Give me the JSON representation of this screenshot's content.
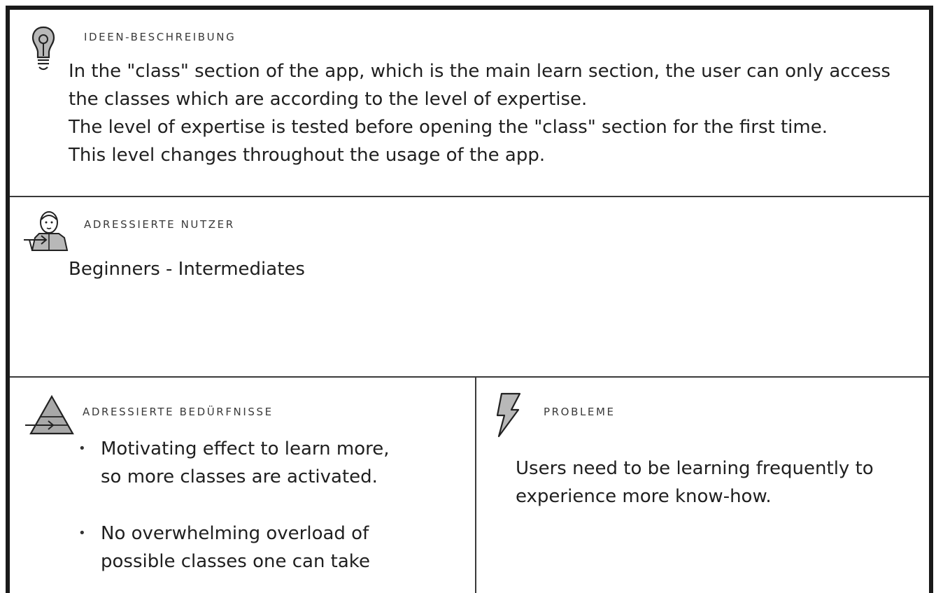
{
  "idea": {
    "heading": "IDEEN-BESCHREIBUNG",
    "icon": "lightbulb-icon",
    "lines": [
      "In the \"class\" section of the app, which is the main learn section, the user can only access",
      "the classes which are according to the level of expertise.",
      "The level of expertise is tested before opening the \"class\" section for the first time.",
      "This level changes throughout the usage of the app."
    ]
  },
  "users": {
    "heading": "ADRESSIERTE NUTZER",
    "icon": "user-person-icon",
    "text": "Beginners - Intermediates"
  },
  "needs": {
    "heading": "ADRESSIERTE BEDÜRFNISSE",
    "icon": "pyramid-icon",
    "items": [
      {
        "line1": "Motivating effect to learn more,",
        "line2": "so more classes are activated."
      },
      {
        "line1": "No overwhelming overload of",
        "line2": "possible classes one can take"
      }
    ]
  },
  "problems": {
    "heading": "PROBLEME",
    "icon": "lightning-icon",
    "lines": [
      "Users need to be learning frequently to",
      "experience more know-how."
    ]
  }
}
